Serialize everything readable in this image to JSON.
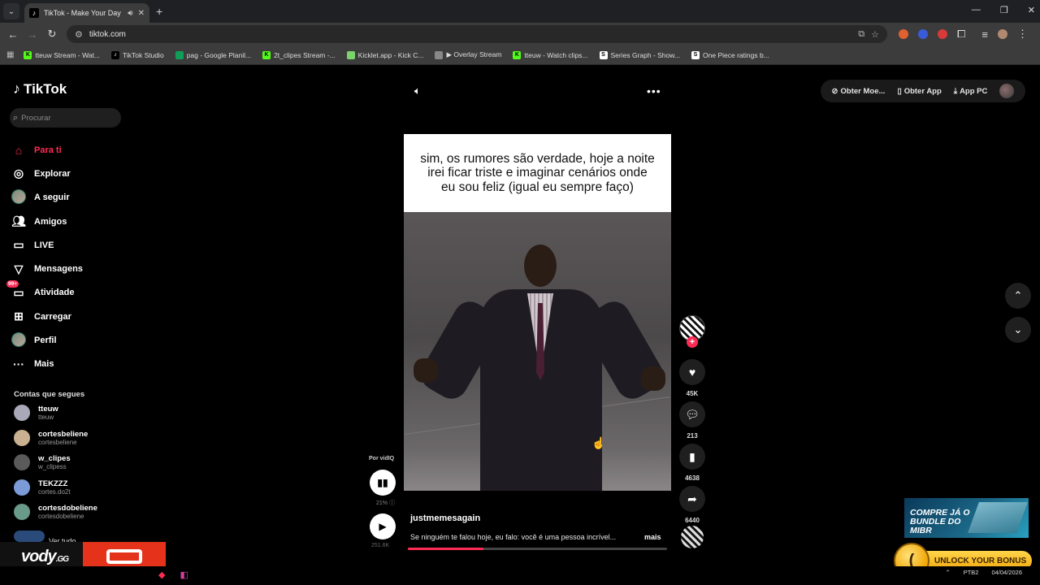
{
  "browser": {
    "tab_title": "TikTok - Make Your Day",
    "tab_favicon": "tiktok-icon",
    "url": "tiktok.com",
    "bookmarks": [
      {
        "label": "tteuw Stream - Wat...",
        "icon": "kick-icon",
        "color": "#53fc18"
      },
      {
        "label": "TikTok Studio",
        "icon": "tiktok-icon",
        "color": "#000000"
      },
      {
        "label": "pag - Google Planil...",
        "icon": "sheets-icon",
        "color": "#0f9d58"
      },
      {
        "label": "2t_clipes Stream -...",
        "icon": "kick-icon",
        "color": "#53fc18"
      },
      {
        "label": "Kicklet.app - Kick C...",
        "icon": "kicklet-icon",
        "color": "#7bd36b"
      },
      {
        "label": "▶ Overlay Stream",
        "icon": "globe-icon",
        "color": "#888888"
      },
      {
        "label": "tteuw - Watch clips...",
        "icon": "kick-icon",
        "color": "#53fc18"
      },
      {
        "label": "Series Graph - Show...",
        "icon": "s-icon",
        "color": "#ffffff"
      },
      {
        "label": "One Piece ratings b...",
        "icon": "s-icon",
        "color": "#ffffff"
      }
    ]
  },
  "sidebar": {
    "logo": "TikTok",
    "search_placeholder": "Procurar",
    "nav": [
      {
        "label": "Para ti",
        "icon": "home-icon",
        "active": true
      },
      {
        "label": "Explorar",
        "icon": "compass-icon"
      },
      {
        "label": "A seguir",
        "icon": "avatar"
      },
      {
        "label": "Amigos",
        "icon": "friends-icon"
      },
      {
        "label": "LIVE",
        "icon": "live-icon"
      },
      {
        "label": "Mensagens",
        "icon": "messages-icon"
      },
      {
        "label": "Atividade",
        "icon": "inbox-icon",
        "badge": "99+"
      },
      {
        "label": "Carregar",
        "icon": "upload-icon"
      },
      {
        "label": "Perfil",
        "icon": "avatar"
      },
      {
        "label": "Mais",
        "icon": "more-icon"
      }
    ],
    "following_title": "Contas que segues",
    "accounts": [
      {
        "name": "tteuw",
        "handle": "tteuw",
        "color": "#a8a8b8"
      },
      {
        "name": "cortesbeliene",
        "handle": "cortesbeliene",
        "color": "#c8b090"
      },
      {
        "name": "w_clipes",
        "handle": "w_clipess",
        "color": "#5a5a5a"
      },
      {
        "name": "TEKZZZ",
        "handle": "cortes.do2t",
        "color": "#7a9ad8"
      },
      {
        "name": "cortesdobeliene",
        "handle": "cortesdobeliene",
        "color": "#6a9a8a"
      }
    ],
    "see_all": "Ver tudo"
  },
  "overlay": {
    "vody_logo": "vody",
    "vody_tld": ".GG"
  },
  "header": {
    "get_coins": "Obter Moe...",
    "get_app": "Obter App",
    "app_pc": "App PC"
  },
  "video": {
    "caption": "sim, os rumores são verdade, hoje a noite irei ficar triste e imaginar cenários onde eu sou feliz (igual eu sempre faço)",
    "author": "justmemesagain",
    "description": "Se ninguém te falou hoje, eu falo: você é uma pessoa incrível...",
    "more": "mais",
    "progress": 0.29,
    "likes": "45K",
    "comments": "213",
    "saves": "4638",
    "shares": "6440",
    "vidiq_by": "Por vidIQ",
    "vidiq_pct": "21%",
    "views": "251.6K"
  },
  "ads": {
    "mibr_text": "COMPRE JÁ O BUNDLE DO MIBR",
    "unlock_text": "UNLOCK YOUR BONUS"
  },
  "taskbar": {
    "lang": "PTB2",
    "date": "04/04/2026"
  }
}
